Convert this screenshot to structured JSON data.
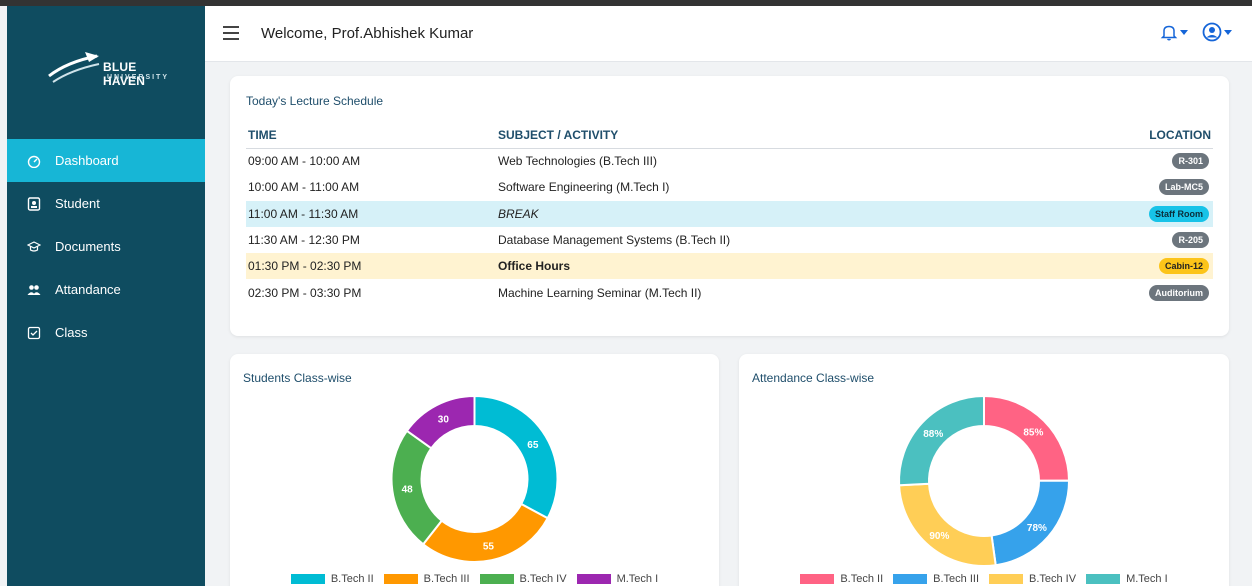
{
  "app": {
    "logo_title": "BLUE HAVEN",
    "logo_subtitle": "UNIVERSITY",
    "welcome": "Welcome, Prof.Abhishek Kumar"
  },
  "sidebar": {
    "items": [
      {
        "label": "Dashboard",
        "icon": "dashboard-icon",
        "active": true
      },
      {
        "label": "Student",
        "icon": "id-card-icon"
      },
      {
        "label": "Documents",
        "icon": "graduation-cap-icon"
      },
      {
        "label": "Attandance",
        "icon": "users-icon"
      },
      {
        "label": "Class",
        "icon": "checklist-icon"
      }
    ]
  },
  "schedule": {
    "title": "Today's Lecture Schedule",
    "columns": {
      "time": "TIME",
      "subject": "SUBJECT / ACTIVITY",
      "location": "LOCATION"
    },
    "rows": [
      {
        "time": "09:00 AM - 10:00 AM",
        "subject": "Web Technologies (B.Tech III)",
        "location": "R-301"
      },
      {
        "time": "10:00 AM - 11:00 AM",
        "subject": "Software Engineering (M.Tech I)",
        "location": "Lab-MC5"
      },
      {
        "time": "11:00 AM - 11:30 AM",
        "subject": "BREAK",
        "location": "Staff Room"
      },
      {
        "time": "11:30 AM - 12:30 PM",
        "subject": "Database Management Systems (B.Tech II)",
        "location": "R-205"
      },
      {
        "time": "01:30 PM - 02:30 PM",
        "subject": "Office Hours",
        "location": "Cabin-12"
      },
      {
        "time": "02:30 PM - 03:30 PM",
        "subject": "Machine Learning Seminar (M.Tech II)",
        "location": "Auditorium"
      }
    ]
  },
  "colors": {
    "sidebar_bg": "#0f4c60",
    "active_nav": "#17b6d6",
    "break_row": "#d6f1f8",
    "office_row": "#fff3d1"
  },
  "chart_data": [
    {
      "type": "pie",
      "title": "Students Class-wise",
      "categories": [
        "B.Tech II",
        "B.Tech III",
        "B.Tech IV",
        "M.Tech I"
      ],
      "values": [
        65,
        55,
        48,
        30
      ],
      "labels": [
        "65",
        "55",
        "48",
        "30"
      ],
      "colors": [
        "#00bcd4",
        "#ff9800",
        "#4caf50",
        "#9c27b0"
      ],
      "legend": "bottom"
    },
    {
      "type": "pie",
      "title": "Attendance Class-wise",
      "categories": [
        "B.Tech II",
        "B.Tech III",
        "B.Tech IV",
        "M.Tech I"
      ],
      "values": [
        85,
        78,
        90,
        88
      ],
      "labels": [
        "85%",
        "78%",
        "90%",
        "88%"
      ],
      "colors": [
        "#ff6384",
        "#36a2eb",
        "#ffce56",
        "#4bc0c0"
      ],
      "legend": "bottom"
    }
  ]
}
